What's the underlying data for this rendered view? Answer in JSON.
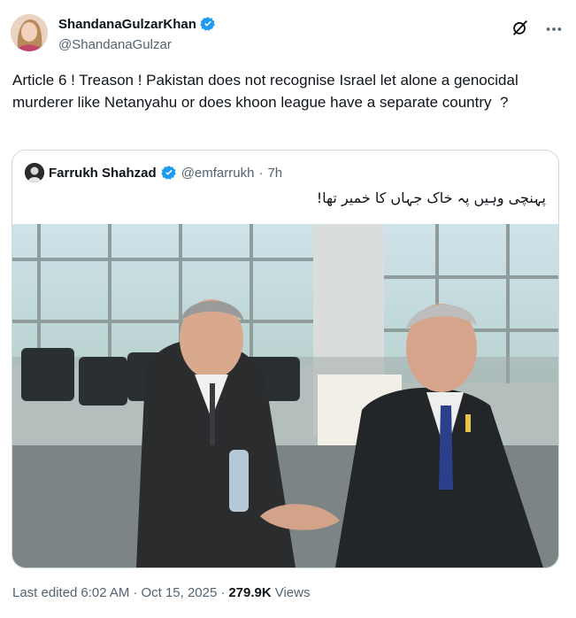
{
  "author": {
    "display_name": "ShandanaGulzarKhan",
    "handle": "@ShandanaGulzar",
    "verified": true,
    "avatar_icon": "profile-photo"
  },
  "header_icons": [
    "grok-icon",
    "more-icon"
  ],
  "tweet": {
    "text": "Article 6 ! Treason ! Pakistan does not recognise Israel let alone a genocidal murderer like Netanyahu or does khoon league have a separate country  ?"
  },
  "quote": {
    "display_name": "Farrukh Shahzad",
    "handle": "@emfarrukh",
    "separator": "·",
    "time": "7h",
    "text": "پہنچی وہیں پہ خاک جہاں کا خمیر تھا!",
    "media_icon": "photo-handshake"
  },
  "meta": {
    "edited_label": "Last edited",
    "time": "6:02 AM",
    "separator": "·",
    "date": "Oct 15, 2025",
    "views_count": "279.9K",
    "views_label": "Views"
  },
  "colors": {
    "text": "#0f1419",
    "secondary": "#536471",
    "verified": "#1d9bf0",
    "border": "#cfd9de"
  }
}
